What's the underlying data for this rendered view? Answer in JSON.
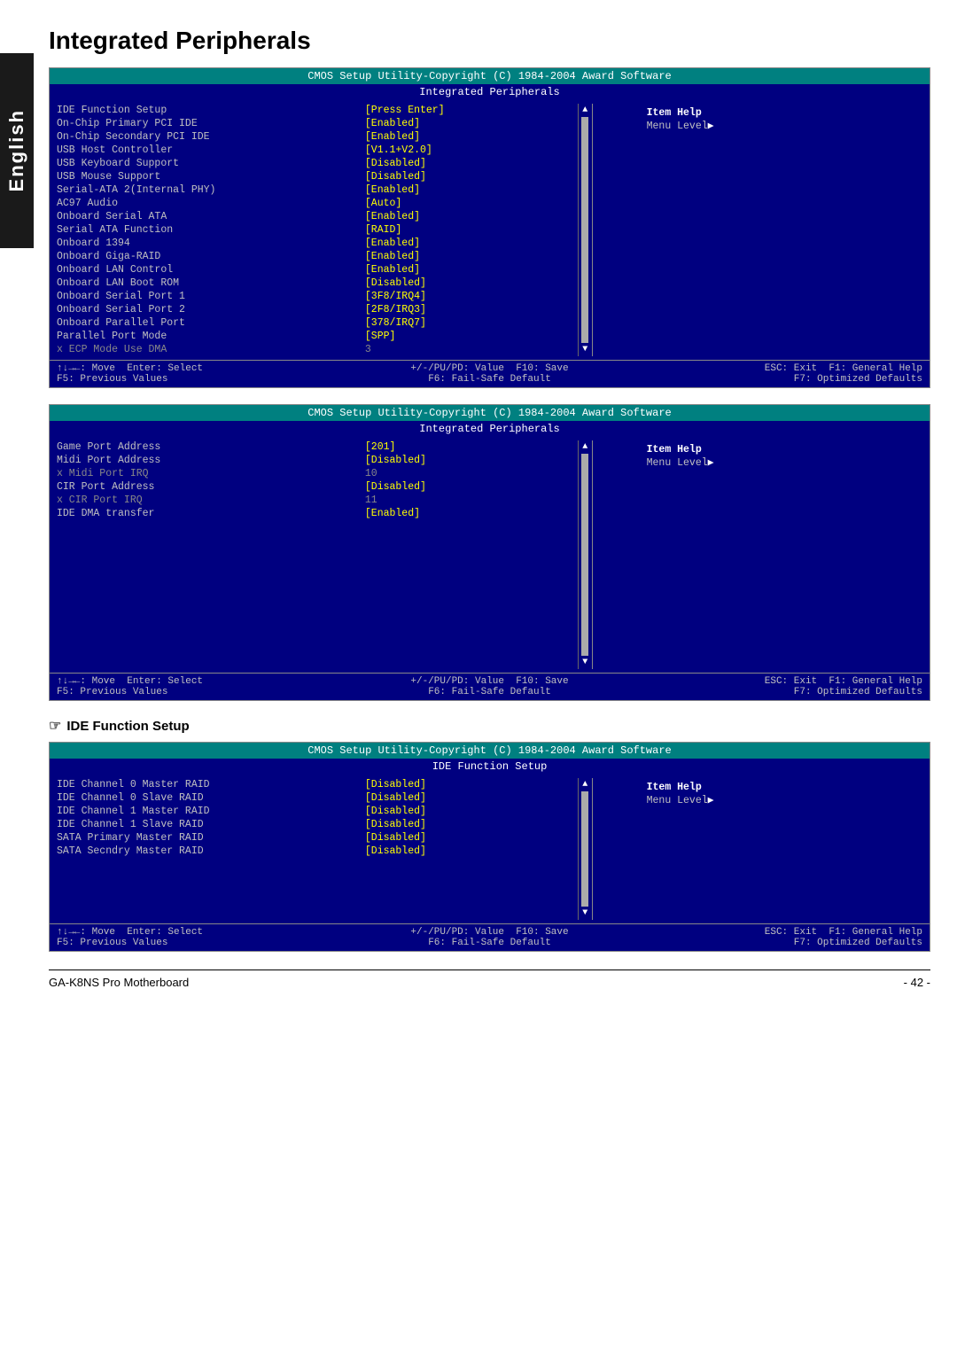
{
  "side_tab": {
    "label": "English"
  },
  "page_title": "Integrated Peripherals",
  "bios_box1": {
    "title1": "CMOS Setup Utility-Copyright (C) 1984-2004 Award Software",
    "title2": "Integrated Peripherals",
    "rows": [
      {
        "label": "IDE Function Setup",
        "value": "[Press Enter]",
        "disabled": false
      },
      {
        "label": "On-Chip Primary PCI IDE",
        "value": "[Enabled]",
        "disabled": false
      },
      {
        "label": "On-Chip Secondary PCI IDE",
        "value": "[Enabled]",
        "disabled": false
      },
      {
        "label": "USB Host Controller",
        "value": "[V1.1+V2.0]",
        "disabled": false
      },
      {
        "label": "USB Keyboard Support",
        "value": "[Disabled]",
        "disabled": false
      },
      {
        "label": "USB Mouse Support",
        "value": "[Disabled]",
        "disabled": false
      },
      {
        "label": "Serial-ATA 2(Internal PHY)",
        "value": "[Enabled]",
        "disabled": false
      },
      {
        "label": "AC97 Audio",
        "value": "[Auto]",
        "disabled": false
      },
      {
        "label": "Onboard Serial ATA",
        "value": "[Enabled]",
        "disabled": false
      },
      {
        "label": "Serial ATA Function",
        "value": "[RAID]",
        "disabled": false
      },
      {
        "label": "Onboard 1394",
        "value": "[Enabled]",
        "disabled": false
      },
      {
        "label": "Onboard Giga-RAID",
        "value": "[Enabled]",
        "disabled": false
      },
      {
        "label": "Onboard LAN Control",
        "value": "[Enabled]",
        "disabled": false
      },
      {
        "label": "Onboard LAN Boot ROM",
        "value": "[Disabled]",
        "disabled": false
      },
      {
        "label": "Onboard Serial Port 1",
        "value": "[3F8/IRQ4]",
        "disabled": false
      },
      {
        "label": "Onboard Serial Port 2",
        "value": "[2F8/IRQ3]",
        "disabled": false
      },
      {
        "label": "Onboard Parallel Port",
        "value": "[378/IRQ7]",
        "disabled": false
      },
      {
        "label": "Parallel Port Mode",
        "value": "[SPP]",
        "disabled": false
      },
      {
        "label": "x  ECP Mode Use DMA",
        "value": "3",
        "disabled": true
      }
    ],
    "item_help_label": "Item Help",
    "menu_level_label": "Menu Level",
    "footer": {
      "move": "↑↓→←: Move",
      "enter": "Enter: Select",
      "value": "+/-/PU/PD: Value",
      "f10": "F10: Save",
      "esc": "ESC: Exit",
      "f1": "F1: General Help",
      "f5": "F5: Previous Values",
      "f6": "F6: Fail-Safe Default",
      "f7": "F7: Optimized Defaults"
    }
  },
  "bios_box2": {
    "title1": "CMOS Setup Utility-Copyright (C) 1984-2004 Award Software",
    "title2": "Integrated Peripherals",
    "rows": [
      {
        "label": "Game Port Address",
        "value": "[201]",
        "disabled": false
      },
      {
        "label": "Midi Port Address",
        "value": "[Disabled]",
        "disabled": false
      },
      {
        "label": "x  Midi Port IRQ",
        "value": "10",
        "disabled": true
      },
      {
        "label": "CIR Port Address",
        "value": "[Disabled]",
        "disabled": false
      },
      {
        "label": "x  CIR Port IRQ",
        "value": "11",
        "disabled": true
      },
      {
        "label": "IDE DMA transfer",
        "value": "[Enabled]",
        "disabled": false
      }
    ],
    "item_help_label": "Item Help",
    "menu_level_label": "Menu Level",
    "footer": {
      "move": "↑↓→←: Move",
      "enter": "Enter: Select",
      "value": "+/-/PU/PD: Value",
      "f10": "F10: Save",
      "esc": "ESC: Exit",
      "f1": "F1: General Help",
      "f5": "F5: Previous Values",
      "f6": "F6: Fail-Safe Default",
      "f7": "F7: Optimized Defaults"
    }
  },
  "ide_section": {
    "heading": "IDE Function Setup",
    "bios_box3": {
      "title1": "CMOS Setup Utility-Copyright (C) 1984-2004 Award Software",
      "title2": "IDE Function Setup",
      "rows": [
        {
          "label": "IDE Channel 0 Master RAID",
          "value": "[Disabled]",
          "disabled": false
        },
        {
          "label": "IDE Channel 0 Slave RAID",
          "value": "[Disabled]",
          "disabled": false
        },
        {
          "label": "IDE Channel 1 Master RAID",
          "value": "[Disabled]",
          "disabled": false
        },
        {
          "label": "IDE Channel 1 Slave RAID",
          "value": "[Disabled]",
          "disabled": false
        },
        {
          "label": "SATA Primary Master RAID",
          "value": "[Disabled]",
          "disabled": false
        },
        {
          "label": "SATA Secndry Master RAID",
          "value": "[Disabled]",
          "disabled": false
        }
      ],
      "item_help_label": "Item Help",
      "menu_level_label": "Menu Level",
      "footer": {
        "move": "↑↓→←: Move",
        "enter": "Enter: Select",
        "value": "+/-/PU/PD: Value",
        "f10": "F10: Save",
        "esc": "ESC: Exit",
        "f1": "F1: General Help",
        "f5": "F5: Previous Values",
        "f6": "F6: Fail-Safe Default",
        "f7": "F7: Optimized Defaults"
      }
    }
  },
  "footer": {
    "left": "GA-K8NS Pro Motherboard",
    "right": "- 42 -"
  }
}
